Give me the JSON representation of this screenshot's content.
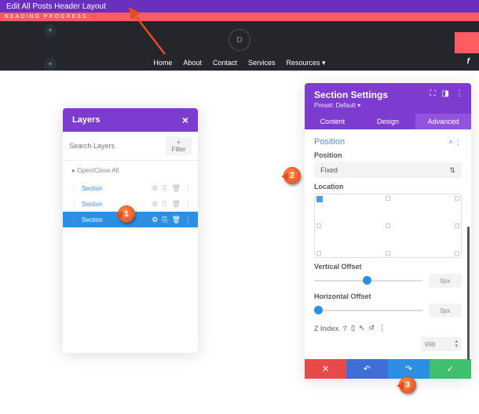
{
  "topbar": {
    "title": "Edit All Posts Header Layout"
  },
  "progress": {
    "label": "READING PROGRESS:"
  },
  "nav": {
    "items": [
      "Home",
      "About",
      "Contact",
      "Services",
      "Resources"
    ]
  },
  "logo": {
    "letter": "D"
  },
  "layers": {
    "title": "Layers",
    "search_placeholder": "Search Layers",
    "filter": "+ Filter",
    "open_close": "Open/Close All",
    "sections": [
      "Section",
      "Section",
      "Section"
    ]
  },
  "settings": {
    "title": "Section Settings",
    "preset": "Preset: Default",
    "tabs": {
      "content": "Content",
      "design": "Design",
      "advanced": "Advanced"
    },
    "position_group": "Position",
    "position_label": "Position",
    "position_value": "Fixed",
    "location_label": "Location",
    "voffset_label": "Vertical Offset",
    "voffset_value": "0px",
    "hoffset_label": "Horizontal Offset",
    "hoffset_value": "0px",
    "zindex_label": "Z Index",
    "zindex_value": "998"
  },
  "markers": {
    "m1": "1",
    "m2": "2",
    "m3": "3"
  }
}
